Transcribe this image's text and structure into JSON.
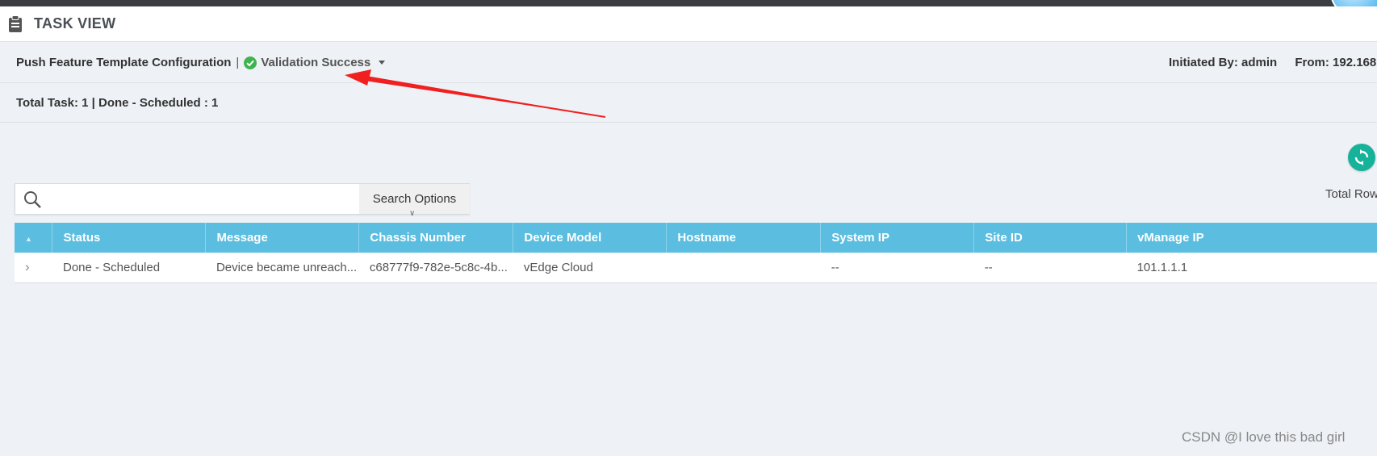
{
  "header": {
    "title": "TASK VIEW"
  },
  "task": {
    "name": "Push Feature Template Configuration",
    "separator": "|",
    "status": "Validation Success",
    "initiated_by": "Initiated By: admin",
    "from": "From: 192.168"
  },
  "summary": {
    "text": "Total Task: 1 | Done - Scheduled : 1"
  },
  "toolbar": {
    "total_rows_label": "Total Row"
  },
  "search": {
    "placeholder": "",
    "options_label": "Search Options",
    "options_chevron": "∨"
  },
  "table": {
    "columns": [
      "",
      "Status",
      "Message",
      "Chassis Number",
      "Device Model",
      "Hostname",
      "System IP",
      "Site ID",
      "vManage IP"
    ],
    "rows": [
      {
        "expand": "›",
        "status": "Done - Scheduled",
        "message": "Device became unreach...",
        "chassis": "c68777f9-782e-5c8c-4b...",
        "model": "vEdge Cloud",
        "hostname": "",
        "system_ip": "--",
        "site_id": "--",
        "vmanage_ip": "101.1.1.1"
      }
    ]
  },
  "watermark": "CSDN @I love this bad girl",
  "colors": {
    "table_header": "#5bbde0",
    "success": "#3fb34f",
    "refresh": "#17b29a",
    "annotation_arrow": "#f02020"
  },
  "icons": {
    "title": "clipboard-icon",
    "status": "check-circle-icon",
    "search": "search-icon",
    "refresh": "refresh-icon"
  }
}
